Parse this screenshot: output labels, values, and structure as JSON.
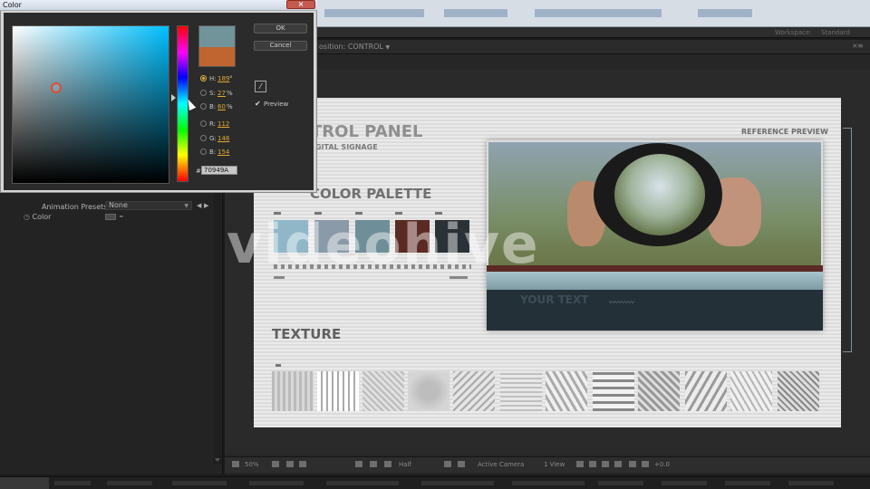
{
  "app": {
    "workspace_label": "Workspace:",
    "workspace_value": "Standard"
  },
  "color_picker": {
    "title": "Color",
    "ok_label": "OK",
    "cancel_label": "Cancel",
    "preview_label": "Preview",
    "preview_checked": true,
    "new_color": "#70949A",
    "old_color": "#C0652F",
    "fields": [
      {
        "label": "H:",
        "value": "189",
        "unit": "°",
        "selected": true
      },
      {
        "label": "S:",
        "value": "27",
        "unit": "%",
        "selected": false
      },
      {
        "label": "B:",
        "value": "60",
        "unit": "%",
        "selected": false
      },
      {
        "label": "R:",
        "value": "112",
        "unit": "",
        "selected": false
      },
      {
        "label": "G:",
        "value": "148",
        "unit": "",
        "selected": false
      },
      {
        "label": "B:",
        "value": "154",
        "unit": "",
        "selected": false
      }
    ],
    "hex_prefix": "#",
    "hex_value": "70949A"
  },
  "effect_controls": {
    "presets_label": "Animation Presets:",
    "presets_value": "None",
    "color_label": "Color"
  },
  "composition": {
    "tab_label": "osition: CONTROL"
  },
  "artboard": {
    "title": "TROL PANEL",
    "subtitle": "IGITAL SIGNAGE",
    "reference_label": "REFERENCE PREVIEW",
    "palette_title": "COLOR PALETTE",
    "texture_title": "TEXTURE",
    "ref_your_text": "YOUR TEXT",
    "palette_colors": [
      "#8fb7c8",
      "#8a9aa8",
      "#6f8f98",
      "#5b2a24",
      "#2a3238"
    ],
    "watermark": "videohive"
  },
  "comp_toolbar": {
    "zoom": "50%",
    "quality": "Half",
    "camera": "Active Camera",
    "views": "1 View",
    "exposure": "+0.0"
  }
}
